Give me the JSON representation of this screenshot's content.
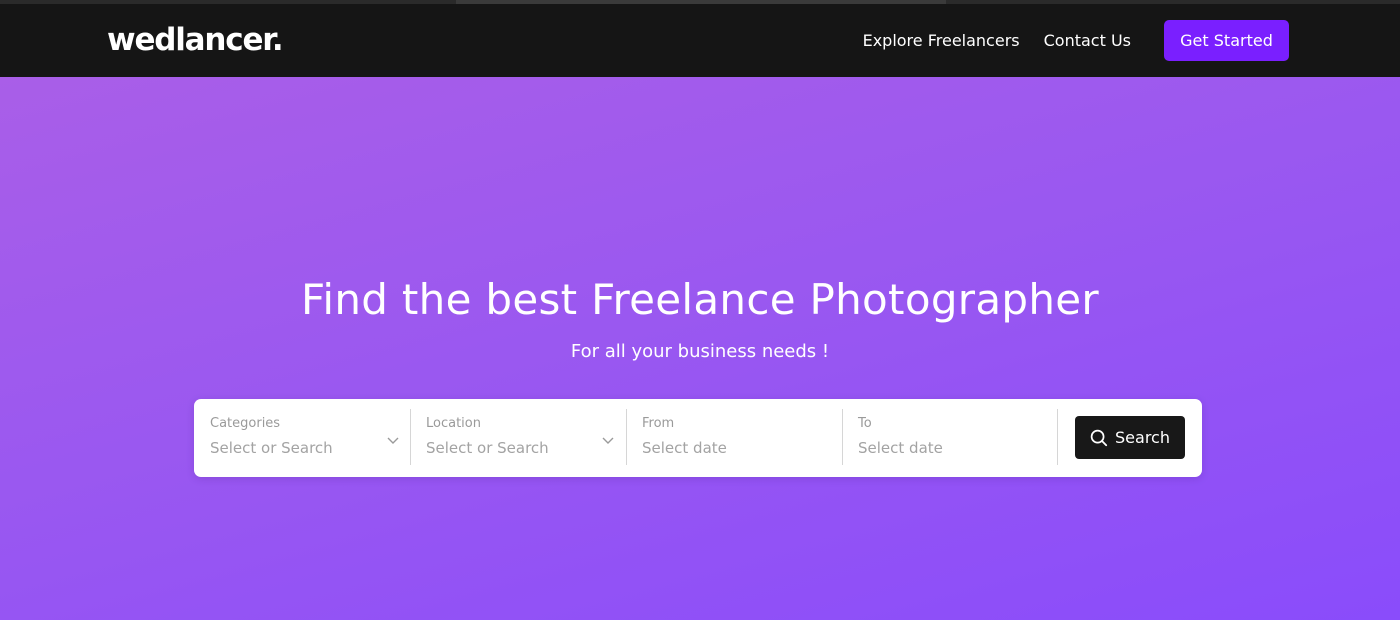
{
  "brand": {
    "logo": "wedlancer."
  },
  "nav": {
    "links": [
      "Explore Freelancers",
      "Contact Us"
    ],
    "cta_label": "Get Started"
  },
  "hero": {
    "title": "Find the best Freelance Photographer",
    "subtitle": "For all your business needs !"
  },
  "search": {
    "fields": [
      {
        "label": "Categories",
        "placeholder": "Select or Search",
        "kind": "dropdown"
      },
      {
        "label": "Location",
        "placeholder": "Select or Search",
        "kind": "dropdown"
      },
      {
        "label": "From",
        "placeholder": "Select date",
        "kind": "date"
      },
      {
        "label": "To",
        "placeholder": "Select date",
        "kind": "date"
      }
    ],
    "button_label": "Search",
    "button_icon": "search-icon"
  },
  "colors": {
    "header_bg": "#151515",
    "accent": "#7a1fff",
    "hero_gradient_start": "#a95ee8",
    "hero_gradient_end": "#8a4cfb",
    "search_button_bg": "#181818"
  }
}
